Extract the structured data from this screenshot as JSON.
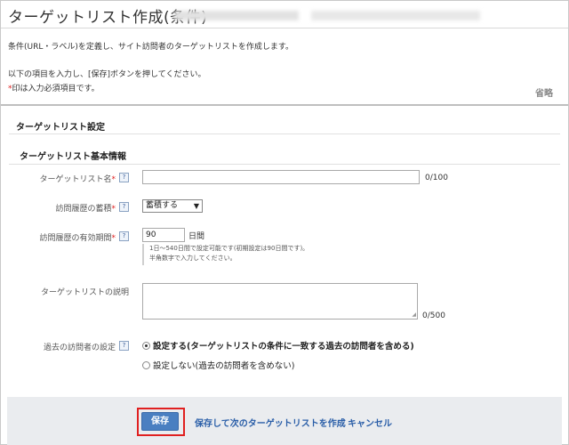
{
  "page": {
    "title": "ターゲットリスト作成(条件)",
    "description": "条件(URL・ラベル)を定義し、サイト訪問者のターゲットリストを作成します。",
    "instruction": "以下の項目を入力し、[保存]ボタンを押してください。",
    "required_mark": "*",
    "required_note": "印は入力必須項目です。",
    "collapse_label": "省略"
  },
  "sections": {
    "settings_title": "ターゲットリスト設定",
    "basic_info_title": "ターゲットリスト基本情報"
  },
  "form": {
    "name_label": "ターゲットリスト名",
    "name_counter": "0/100",
    "accumulate_label": "訪問履歴の蓄積",
    "accumulate_value": "蓄積する",
    "validity_label": "訪問履歴の有効期間",
    "validity_value": "90",
    "validity_unit": "日間",
    "validity_note_line1": "1日〜540日間で設定可能です(初期設定は90日間です)。",
    "validity_note_line2": "半角数字で入力してください。",
    "desc_label": "ターゲットリストの説明",
    "desc_counter": "0/500",
    "past_label": "過去の訪問者の設定",
    "past_option_yes": "設定する(ターゲットリストの条件に一致する過去の訪問者を含める)",
    "past_option_no": "設定しない(過去の訪問者を含めない)",
    "help_glyph": "?"
  },
  "footer": {
    "save_label": "保存",
    "save_next_label": "保存して次のターゲットリストを作成",
    "cancel_label": "キャンセル"
  },
  "colors": {
    "required": "#e02020",
    "primary_button": "#4a7fc1",
    "link": "#2a5ea8",
    "highlight_outline": "#e02020"
  }
}
